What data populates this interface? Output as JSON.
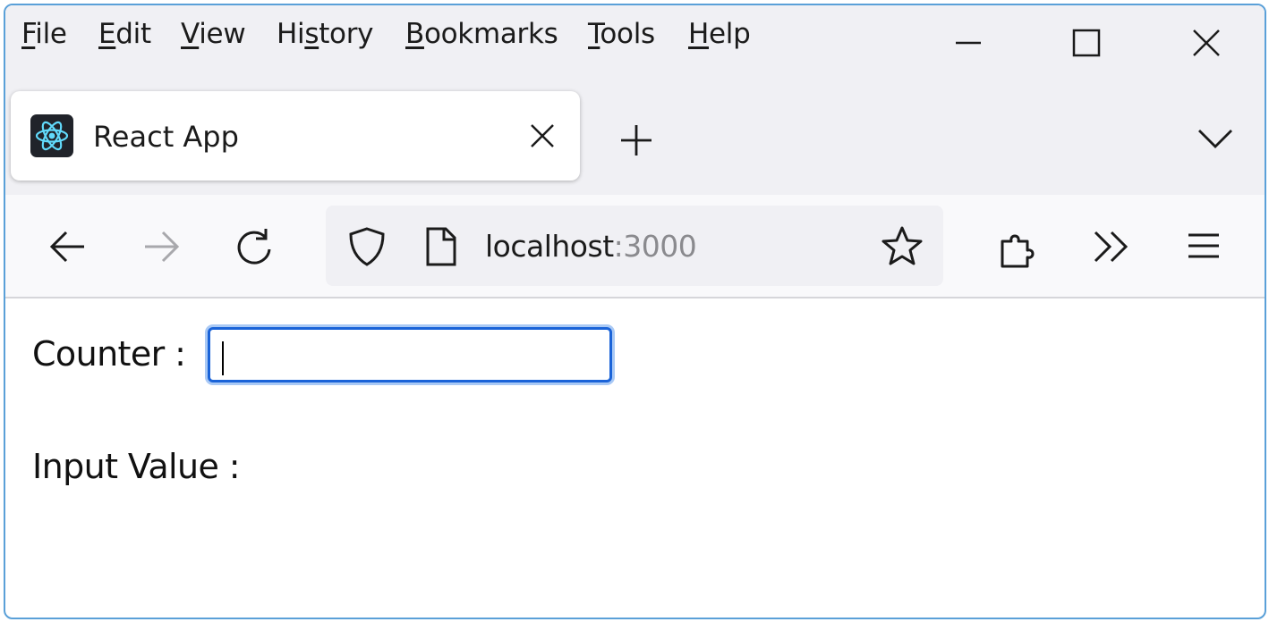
{
  "menubar": {
    "items": [
      {
        "pre": "",
        "ul": "F",
        "post": "ile"
      },
      {
        "pre": "",
        "ul": "E",
        "post": "dit"
      },
      {
        "pre": "",
        "ul": "V",
        "post": "iew"
      },
      {
        "pre": "Hi",
        "ul": "s",
        "post": "tory"
      },
      {
        "pre": "",
        "ul": "B",
        "post": "ookmarks"
      },
      {
        "pre": "",
        "ul": "T",
        "post": "ools"
      },
      {
        "pre": "",
        "ul": "H",
        "post": "elp"
      }
    ]
  },
  "tab": {
    "title": "React App"
  },
  "urlbar": {
    "host": "localhost",
    "port": ":3000"
  },
  "content": {
    "counter_label": "Counter :",
    "counter_value": "",
    "output_label": "Input Value :",
    "output_value": ""
  },
  "colors": {
    "accent": "#1a63d8",
    "react": "#61dafb"
  }
}
